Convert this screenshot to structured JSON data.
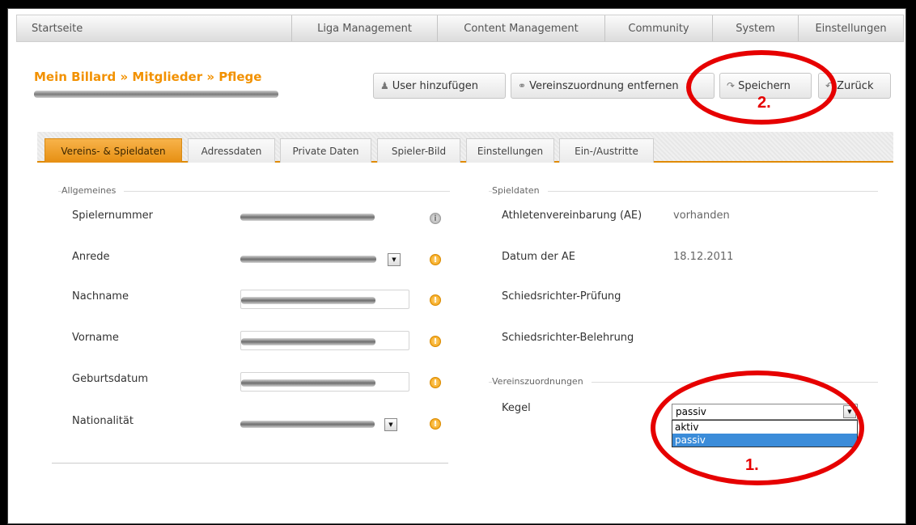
{
  "nav": {
    "items": [
      {
        "label": "Startseite"
      },
      {
        "label": "Liga Management"
      },
      {
        "label": "Content Management"
      },
      {
        "label": "Community"
      },
      {
        "label": "System"
      },
      {
        "label": "Einstellungen"
      }
    ]
  },
  "breadcrumb": "Mein Billard » Mitglieder » Pflege",
  "toolbar": {
    "add_user": "User hinzufügen",
    "remove_assoc": "Vereinszuordnung entfernen",
    "save": "Speichern",
    "back": "Zurück"
  },
  "tabs": [
    {
      "label": "Vereins- & Spieldaten",
      "active": true
    },
    {
      "label": "Adressdaten"
    },
    {
      "label": "Private Daten"
    },
    {
      "label": "Spieler-Bild"
    },
    {
      "label": "Einstellungen"
    },
    {
      "label": "Ein-/Austritte"
    }
  ],
  "general": {
    "title": "Allgemeines",
    "fields": [
      {
        "label": "Spielernummer"
      },
      {
        "label": "Anrede"
      },
      {
        "label": "Nachname"
      },
      {
        "label": "Vorname"
      },
      {
        "label": "Geburtsdatum"
      },
      {
        "label": "Nationalität"
      }
    ]
  },
  "game": {
    "title": "Spieldaten",
    "rows": [
      {
        "label": "Athletenvereinbarung (AE)",
        "value": "vorhanden"
      },
      {
        "label": "Datum der AE",
        "value": "18.12.2011"
      },
      {
        "label": "Schiedsrichter-Prüfung",
        "value": ""
      },
      {
        "label": "Schiedsrichter-Belehrung",
        "value": ""
      }
    ]
  },
  "assoc": {
    "title": "Vereinszuordnungen",
    "label": "Kegel",
    "selected": "passiv",
    "options": [
      "aktiv",
      "passiv"
    ]
  },
  "annotations": {
    "one": "1.",
    "two": "2."
  },
  "colors": {
    "accent": "#f29100",
    "annotation": "#e60000"
  }
}
